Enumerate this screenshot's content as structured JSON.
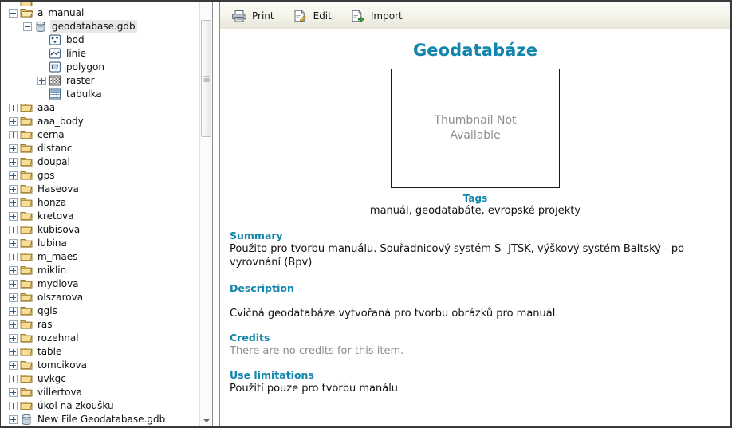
{
  "toolbar": {
    "buttons": [
      {
        "label": "Print",
        "icon": "printer-icon"
      },
      {
        "label": "Edit",
        "icon": "edit-pencil-icon"
      },
      {
        "label": "Import",
        "icon": "import-document-icon"
      }
    ]
  },
  "colors": {
    "accent": "#1185ab",
    "muted_text": "#8c8c8c",
    "thumb_text": "#8a8f94",
    "body_text": "#111111",
    "toolbar_border": "#b9b9a8",
    "selection": "#e8e8e8"
  },
  "tree": {
    "items": [
      {
        "label": "",
        "depth": 0,
        "expander": "none",
        "icon": "folder-icon",
        "selected": false,
        "partial": true
      },
      {
        "label": "a_manual",
        "depth": 0,
        "expander": "minus",
        "icon": "folder-open-icon",
        "selected": false
      },
      {
        "label": "geodatabase.gdb",
        "depth": 1,
        "expander": "minus",
        "icon": "geodatabase-icon",
        "selected": true
      },
      {
        "label": "bod",
        "depth": 2,
        "expander": "none",
        "icon": "point-feature-icon",
        "selected": false
      },
      {
        "label": "linie",
        "depth": 2,
        "expander": "none",
        "icon": "line-feature-icon",
        "selected": false
      },
      {
        "label": "polygon",
        "depth": 2,
        "expander": "none",
        "icon": "polygon-feature-icon",
        "selected": false
      },
      {
        "label": "raster",
        "depth": 2,
        "expander": "plus",
        "icon": "raster-icon",
        "selected": false
      },
      {
        "label": "tabulka",
        "depth": 2,
        "expander": "none",
        "icon": "table-icon",
        "selected": false
      },
      {
        "label": "aaa",
        "depth": 0,
        "expander": "plus",
        "icon": "folder-icon",
        "selected": false
      },
      {
        "label": "aaa_body",
        "depth": 0,
        "expander": "plus",
        "icon": "folder-icon",
        "selected": false
      },
      {
        "label": "cerna",
        "depth": 0,
        "expander": "plus",
        "icon": "folder-icon",
        "selected": false
      },
      {
        "label": "distanc",
        "depth": 0,
        "expander": "plus",
        "icon": "folder-icon",
        "selected": false
      },
      {
        "label": "doupal",
        "depth": 0,
        "expander": "plus",
        "icon": "folder-icon",
        "selected": false
      },
      {
        "label": "gps",
        "depth": 0,
        "expander": "plus",
        "icon": "folder-icon",
        "selected": false
      },
      {
        "label": "Haseova",
        "depth": 0,
        "expander": "plus",
        "icon": "folder-icon",
        "selected": false
      },
      {
        "label": "honza",
        "depth": 0,
        "expander": "plus",
        "icon": "folder-icon",
        "selected": false
      },
      {
        "label": "kretova",
        "depth": 0,
        "expander": "plus",
        "icon": "folder-icon",
        "selected": false
      },
      {
        "label": "kubisova",
        "depth": 0,
        "expander": "plus",
        "icon": "folder-icon",
        "selected": false
      },
      {
        "label": "lubina",
        "depth": 0,
        "expander": "plus",
        "icon": "folder-icon",
        "selected": false
      },
      {
        "label": "m_maes",
        "depth": 0,
        "expander": "plus",
        "icon": "folder-icon",
        "selected": false
      },
      {
        "label": "miklin",
        "depth": 0,
        "expander": "plus",
        "icon": "folder-icon",
        "selected": false
      },
      {
        "label": "mydlova",
        "depth": 0,
        "expander": "plus",
        "icon": "folder-icon",
        "selected": false
      },
      {
        "label": "olszarova",
        "depth": 0,
        "expander": "plus",
        "icon": "folder-icon",
        "selected": false
      },
      {
        "label": "qgis",
        "depth": 0,
        "expander": "plus",
        "icon": "folder-icon",
        "selected": false
      },
      {
        "label": "ras",
        "depth": 0,
        "expander": "plus",
        "icon": "folder-icon",
        "selected": false
      },
      {
        "label": "rozehnal",
        "depth": 0,
        "expander": "plus",
        "icon": "folder-icon",
        "selected": false
      },
      {
        "label": "table",
        "depth": 0,
        "expander": "plus",
        "icon": "folder-icon",
        "selected": false
      },
      {
        "label": "tomcikova",
        "depth": 0,
        "expander": "plus",
        "icon": "folder-icon",
        "selected": false
      },
      {
        "label": "uvkgc",
        "depth": 0,
        "expander": "plus",
        "icon": "folder-icon",
        "selected": false
      },
      {
        "label": "villertova",
        "depth": 0,
        "expander": "plus",
        "icon": "folder-icon",
        "selected": false
      },
      {
        "label": "úkol na zkoušku",
        "depth": 0,
        "expander": "plus",
        "icon": "folder-icon",
        "selected": false
      },
      {
        "label": "New File Geodatabase.gdb",
        "depth": 0,
        "expander": "plus",
        "icon": "geodatabase-icon",
        "selected": false
      }
    ]
  },
  "metadata": {
    "title": "Geodatabáze",
    "thumbnail_text_line1": "Thumbnail Not",
    "thumbnail_text_line2": "Available",
    "tags_heading": "Tags",
    "tags_value": "manuál, geodatabáte, evropské projekty",
    "summary_heading": "Summary",
    "summary_value": "Použito pro tvorbu manuálu. Souřadnicový systém S- JTSK, výškový systém Baltský - po vyrovnání (Bpv)",
    "description_heading": "Description",
    "description_value": "Cvičná geodatabáze vytvořaná pro tvorbu obrázků pro manuál.",
    "credits_heading": "Credits",
    "credits_value": "There are no credits for this item.",
    "use_limitations_heading": "Use limitations",
    "use_limitations_value": "Použití pouze pro tvorbu manálu"
  }
}
